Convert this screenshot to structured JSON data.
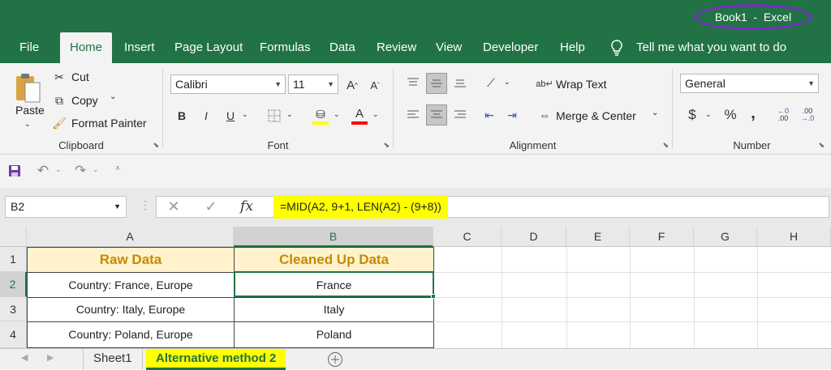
{
  "window": {
    "title": "Book1  -  Excel"
  },
  "tabs": [
    "File",
    "Home",
    "Insert",
    "Page Layout",
    "Formulas",
    "Data",
    "Review",
    "View",
    "Developer",
    "Help"
  ],
  "tell_me": "Tell me what you want to do",
  "clipboard": {
    "paste": "Paste",
    "cut": "Cut",
    "copy": "Copy",
    "format_painter": "Format Painter",
    "label": "Clipboard"
  },
  "font": {
    "name": "Calibri",
    "size": "11",
    "bold": "B",
    "italic": "I",
    "underline": "U",
    "label": "Font",
    "fill_color": "#ffff00",
    "font_color": "#ff0000"
  },
  "alignment": {
    "wrap_text": "Wrap Text",
    "merge_center": "Merge & Center",
    "label": "Alignment"
  },
  "number": {
    "format": "General",
    "currency": "$",
    "percent": "%",
    "comma": ",",
    "label": "Number"
  },
  "formula_bar": {
    "name_box": "B2",
    "fx": "fx",
    "formula": "=MID(A2, 9+1, LEN(A2) - (9+8))"
  },
  "columns": [
    "A",
    "B",
    "C",
    "D",
    "E",
    "F",
    "G",
    "H"
  ],
  "rows": [
    "1",
    "2",
    "3",
    "4"
  ],
  "cells": [
    [
      "Raw Data",
      "Cleaned Up Data"
    ],
    [
      "Country: France, Europe",
      "France"
    ],
    [
      "Country: Italy, Europe",
      "Italy"
    ],
    [
      "Country: Poland, Europe",
      "Poland"
    ]
  ],
  "sheets": [
    "Sheet1",
    "Alternative method 2"
  ],
  "colors": {
    "excel_green": "#217346",
    "header_fill": "#fff2cc",
    "header_text": "#c58b00",
    "highlight": "#ffff00",
    "oval": "#7a2cc4"
  }
}
